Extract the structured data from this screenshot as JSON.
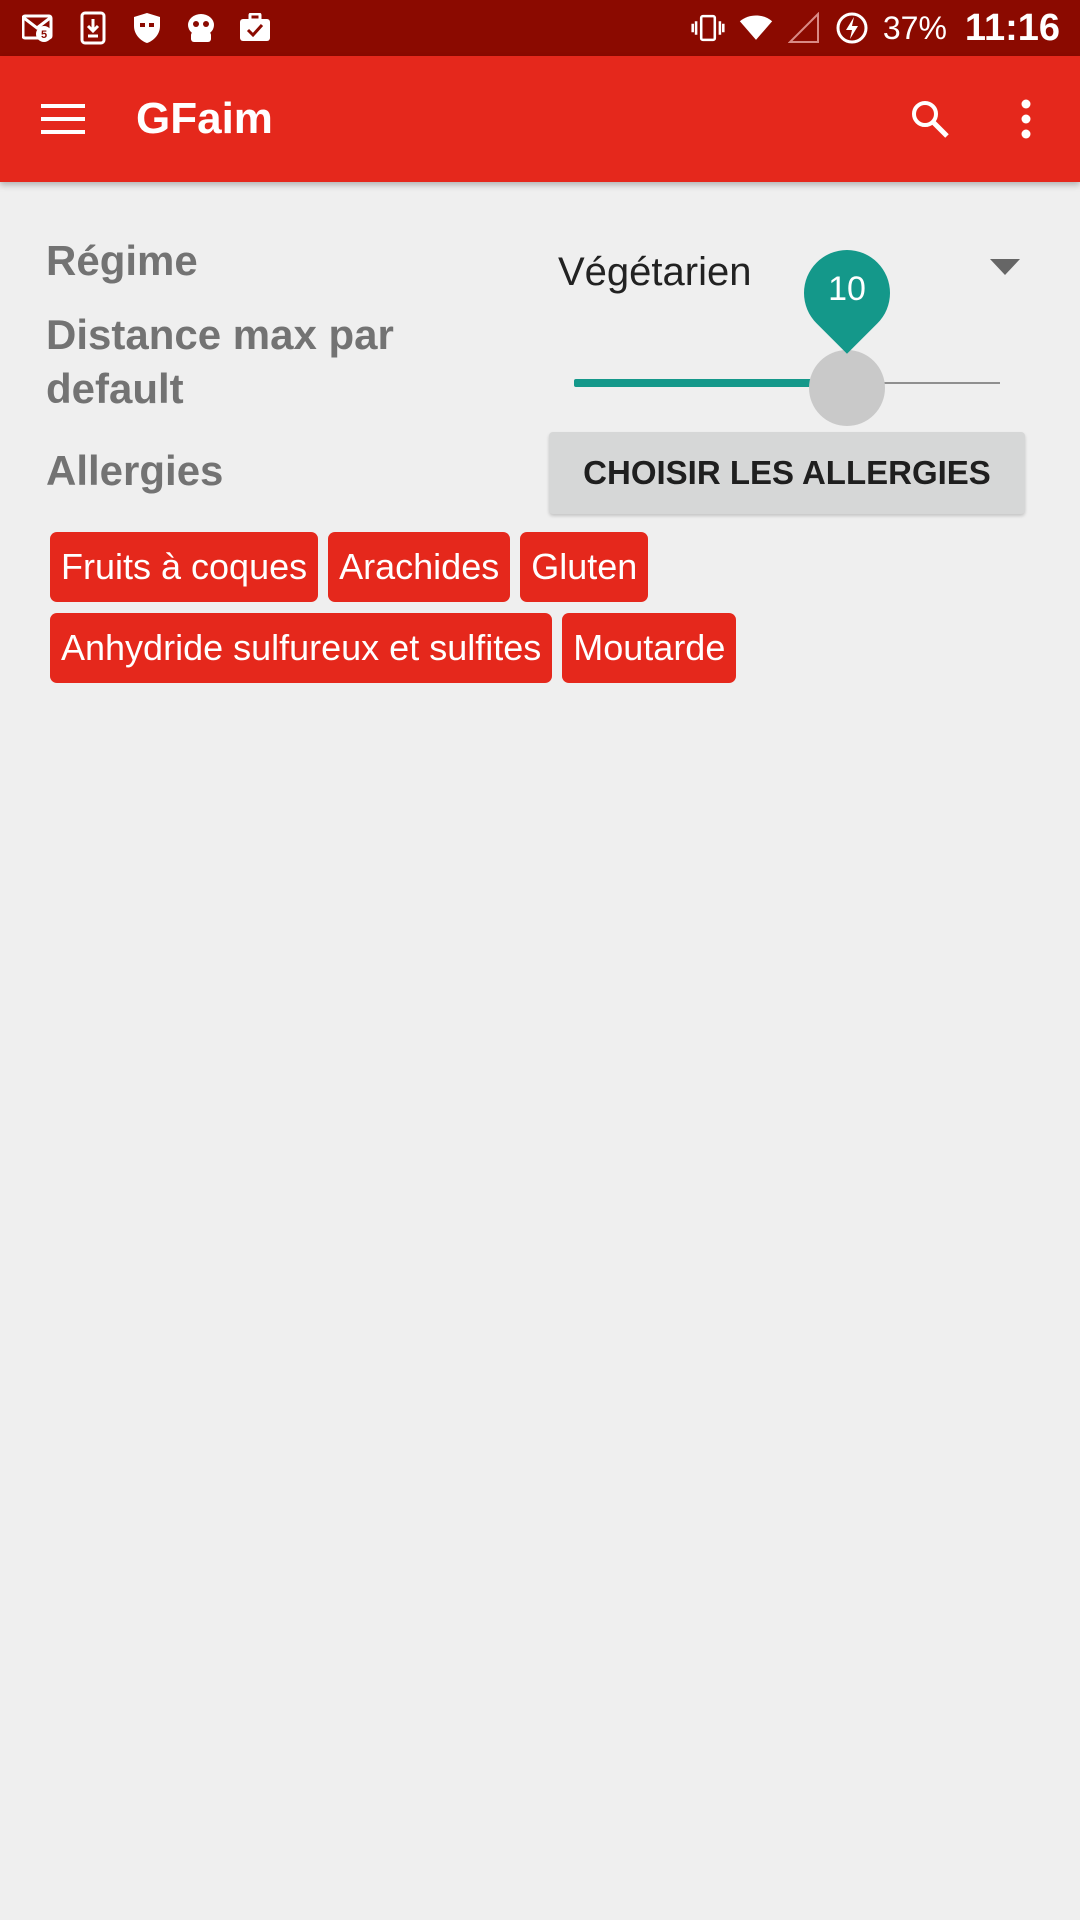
{
  "status_bar": {
    "notification_icons": [
      "gmail-icon",
      "download-icon",
      "shield-icon",
      "cyanogen-icon",
      "briefcase-check-icon"
    ],
    "gmail_badge": "5",
    "battery_percent": "37%",
    "time": "11:16"
  },
  "app_bar": {
    "title": "GFaim"
  },
  "form": {
    "regime_label": "Régime",
    "regime_value": "Végétarien",
    "distance_label": "Distance max par default",
    "distance_value": "10",
    "distance_fraction": 0.64,
    "allergies_label": "Allergies",
    "allergies_button": "CHOISIR LES ALLERGIES"
  },
  "allergies": [
    "Fruits à coques",
    "Arachides",
    "Gluten",
    "Anhydride sulfureux et sulfites",
    "Moutarde"
  ],
  "colors": {
    "status_bar": "#8b0a00",
    "app_bar": "#e5281c",
    "accent": "#14988a",
    "chip": "#e5281c",
    "label_text": "#737373"
  }
}
